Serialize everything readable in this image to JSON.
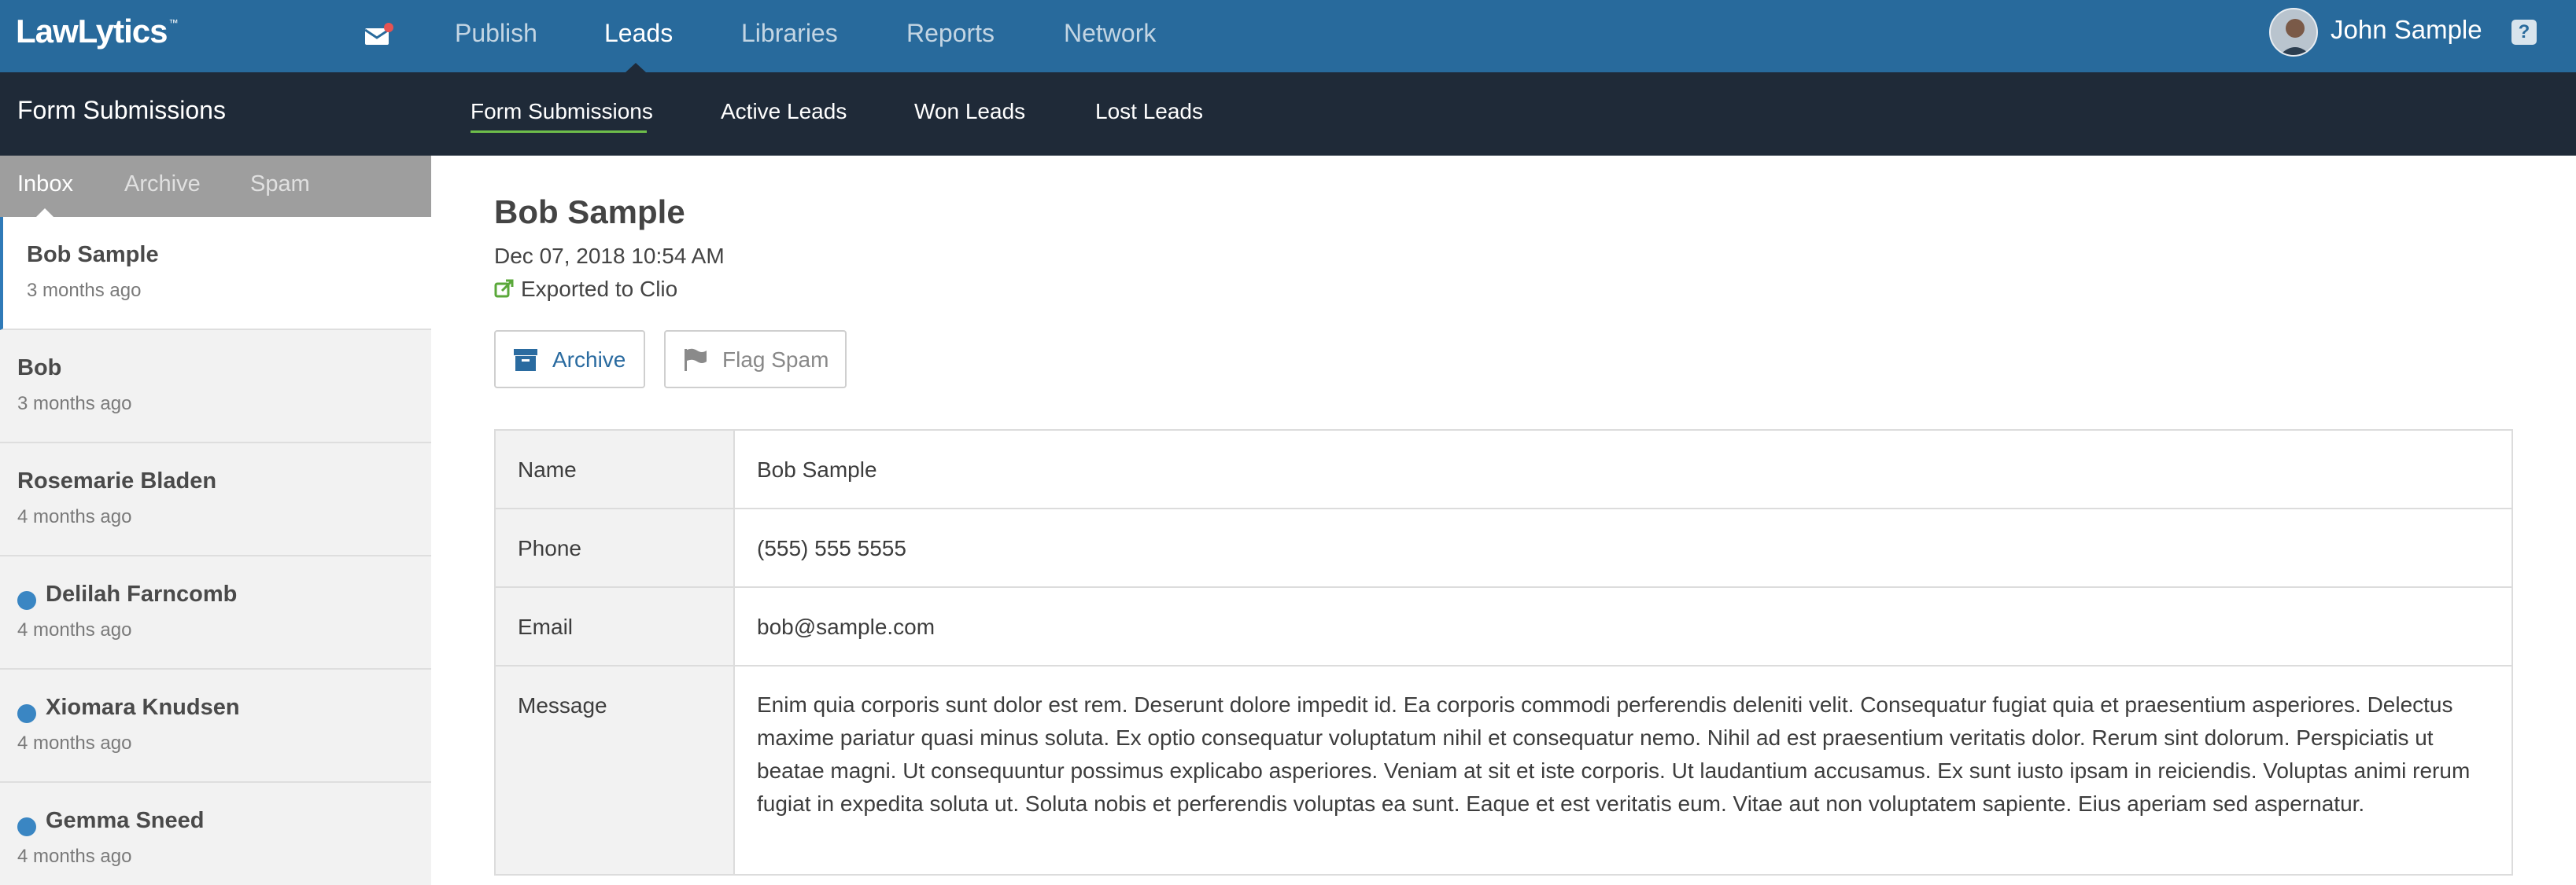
{
  "app": {
    "logo": "LawLytics",
    "logo_mark": "™"
  },
  "topnav": {
    "items": [
      {
        "label": "Publish",
        "active": false
      },
      {
        "label": "Leads",
        "active": true
      },
      {
        "label": "Libraries",
        "active": false
      },
      {
        "label": "Reports",
        "active": false
      },
      {
        "label": "Network",
        "active": false
      }
    ],
    "user_name": "John Sample",
    "help_label": "?"
  },
  "subnav": {
    "section_title": "Form Submissions",
    "items": [
      {
        "label": "Form Submissions",
        "active": true
      },
      {
        "label": "Active Leads",
        "active": false
      },
      {
        "label": "Won Leads",
        "active": false
      },
      {
        "label": "Lost Leads",
        "active": false
      }
    ]
  },
  "sidebar": {
    "tabs": [
      {
        "label": "Inbox",
        "active": true
      },
      {
        "label": "Archive",
        "active": false
      },
      {
        "label": "Spam",
        "active": false
      }
    ],
    "leads": [
      {
        "name": "Bob Sample",
        "time": "3 months ago",
        "selected": true,
        "unread": false
      },
      {
        "name": "Bob",
        "time": "3 months ago",
        "selected": false,
        "unread": false
      },
      {
        "name": "Rosemarie Bladen",
        "time": "4 months ago",
        "selected": false,
        "unread": false
      },
      {
        "name": "Delilah Farncomb",
        "time": "4 months ago",
        "selected": false,
        "unread": true
      },
      {
        "name": "Xiomara Knudsen",
        "time": "4 months ago",
        "selected": false,
        "unread": true
      },
      {
        "name": "Gemma Sneed",
        "time": "4 months ago",
        "selected": false,
        "unread": true
      }
    ]
  },
  "detail": {
    "name": "Bob Sample",
    "date": "Dec 07, 2018 10:54 AM",
    "export_status": "Exported to Clio",
    "archive_label": "Archive",
    "flag_spam_label": "Flag Spam",
    "fields": {
      "name_label": "Name",
      "name_value": "Bob Sample",
      "phone_label": "Phone",
      "phone_value": "(555) 555 5555",
      "email_label": "Email",
      "email_value": "bob@sample.com",
      "message_label": "Message",
      "message_value": "Enim quia corporis sunt dolor est rem. Deserunt dolore impedit id. Ea corporis commodi perferendis deleniti velit. Consequatur fugiat quia et praesentium asperiores. Delectus maxime pariatur quasi minus soluta. Ex optio consequatur voluptatum nihil et consequatur nemo. Nihil ad est praesentium veritatis dolor. Rerum sint dolorum. Perspiciatis ut beatae magni. Ut consequuntur possimus explicabo asperiores. Veniam at sit et iste corporis. Ut laudantium accusamus. Ex sunt iusto ipsam in reiciendis. Voluptas animi rerum fugiat in expedita soluta ut. Soluta nobis et perferendis voluptas ea sunt. Eaque et est veritatis eum. Vitae aut non voluptatem sapiente. Eius aperiam sed aspernatur."
    }
  },
  "icons": {
    "mail": "envelope-icon",
    "export": "external-link-icon",
    "archive": "archive-box-icon",
    "flag": "flag-icon",
    "help": "help-icon"
  },
  "colors": {
    "topbar": "#286a9c",
    "subbar": "#1f2a38",
    "accent_green": "#6ebe4a",
    "unread_dot": "#3a86c3",
    "notification": "#e55353"
  }
}
